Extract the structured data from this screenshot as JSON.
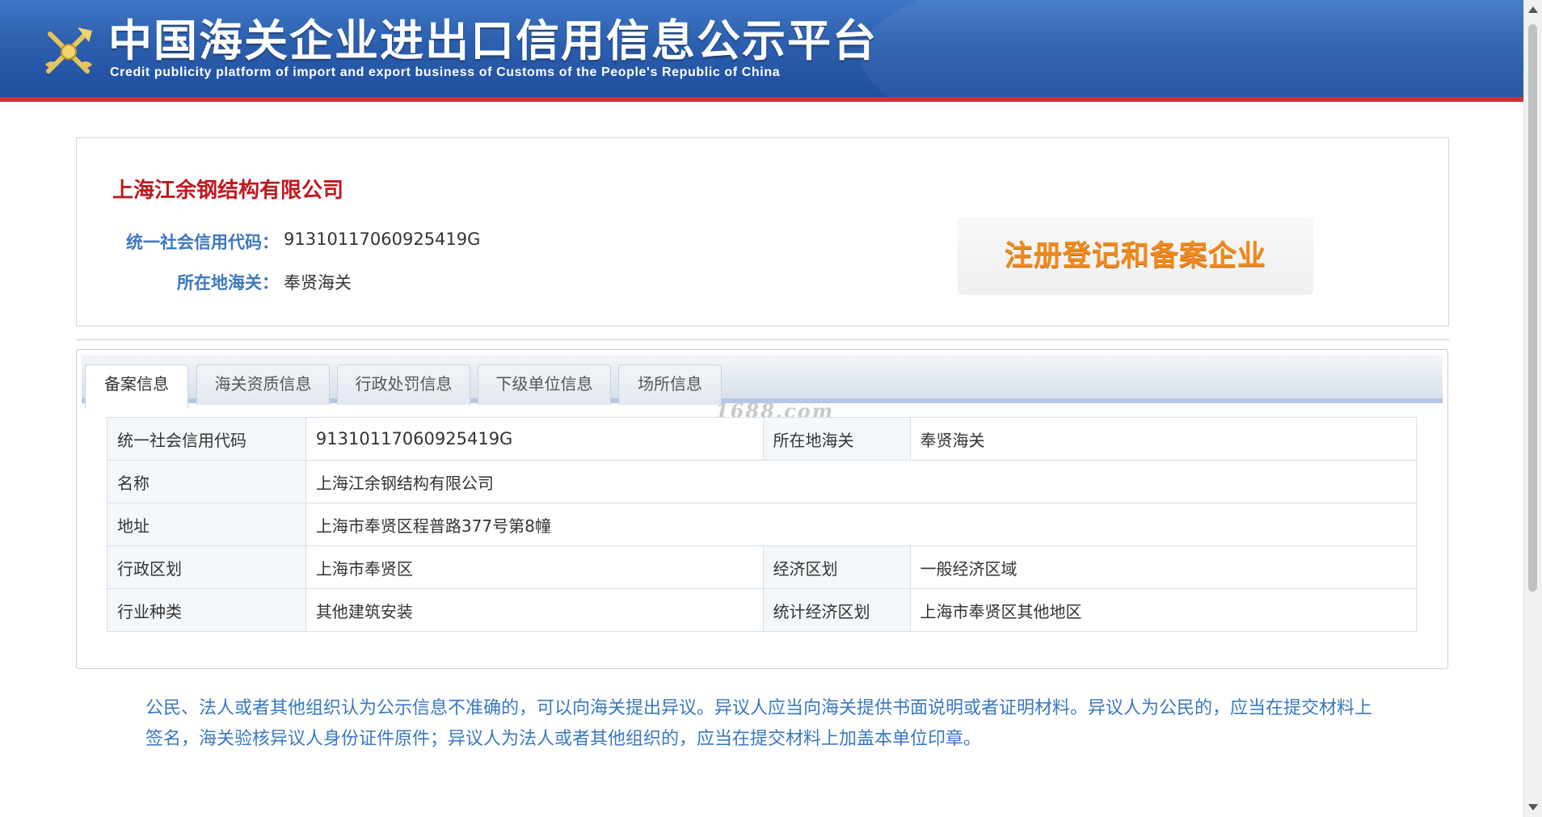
{
  "header": {
    "title": "中国海关企业进出口信用信息公示平台",
    "subtitle": "Credit publicity platform of import and export business of Customs of the People's Republic of China",
    "logo_icon": "customs-emblem-icon",
    "colors": {
      "primary": "#2c5fae",
      "accent_line": "#c8343b"
    }
  },
  "company": {
    "name": "上海江余钢结构有限公司",
    "credit_code_label": "统一社会信用代码：",
    "credit_code": "91310117060925419G",
    "customs_label": "所在地海关：",
    "customs": "奉贤海关",
    "status": "注册登记和备案企业",
    "colors": {
      "name": "#c0181f",
      "label": "#3d78bd",
      "status": "#f08a1c"
    }
  },
  "tabs": [
    {
      "label": "备案信息",
      "active": true
    },
    {
      "label": "海关资质信息",
      "active": false
    },
    {
      "label": "行政处罚信息",
      "active": false
    },
    {
      "label": "下级单位信息",
      "active": false
    },
    {
      "label": "场所信息",
      "active": false
    }
  ],
  "watermark": "1688.com",
  "details": {
    "rows": [
      {
        "l1": "统一社会信用代码",
        "v1": "91310117060925419G",
        "l2": "所在地海关",
        "v2": "奉贤海关"
      },
      {
        "l1": "名称",
        "v1": "上海江余钢结构有限公司"
      },
      {
        "l1": "地址",
        "v1": "上海市奉贤区程普路377号第8幢"
      },
      {
        "l1": "行政区划",
        "v1": "上海市奉贤区",
        "l2": "经济区划",
        "v2": "一般经济区域"
      },
      {
        "l1": "行业种类",
        "v1": "其他建筑安装",
        "l2": "统计经济区划",
        "v2": "上海市奉贤区其他地区"
      }
    ]
  },
  "notice": "公民、法人或者其他组织认为公示信息不准确的，可以向海关提出异议。异议人应当向海关提供书面说明或者证明材料。异议人为公民的，应当在提交材料上签名，海关验核异议人身份证件原件；异议人为法人或者其他组织的，应当在提交材料上加盖本单位印章。"
}
